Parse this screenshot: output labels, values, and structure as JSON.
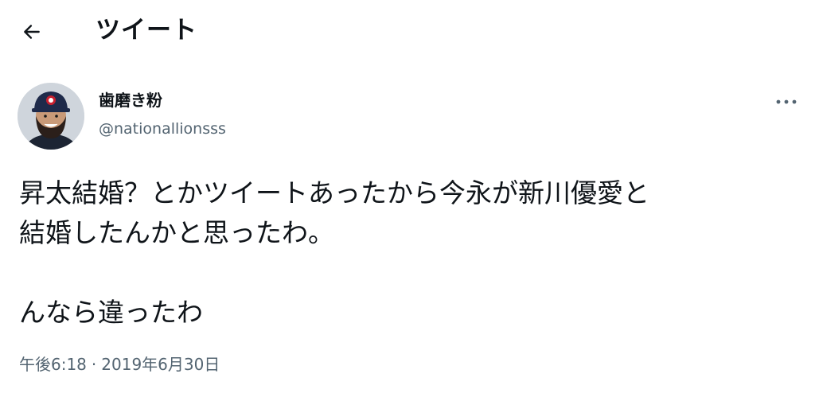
{
  "header": {
    "back_icon": "arrow-left-icon",
    "title": "ツイート"
  },
  "tweet": {
    "author": {
      "name": "歯磨き粉",
      "handle": "@nationallionsss"
    },
    "more_icon": "more-horizontal-icon",
    "text": "昇太結婚？とかツイートあったから今永が新川優愛と\n結婚したんかと思ったわ。\n\nんなら違ったわ",
    "time": "午後6:18",
    "separator": "·",
    "date": "2019年6月30日"
  },
  "colors": {
    "text": "#0f1419",
    "secondary": "#536471",
    "background": "#ffffff"
  }
}
